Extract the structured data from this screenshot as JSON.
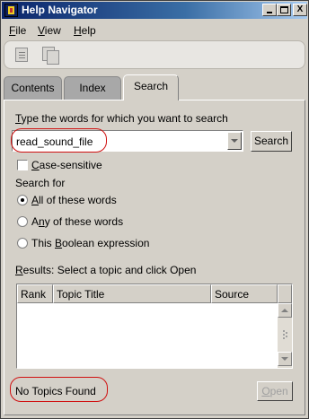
{
  "window": {
    "title": "Help Navigator",
    "controls": {
      "minimize": "minimize",
      "maximize": "maximize",
      "close": "X"
    }
  },
  "menu": {
    "file": {
      "first": "F",
      "rest": "ile"
    },
    "view": {
      "first": "V",
      "rest": "iew"
    },
    "help": {
      "first": "H",
      "rest": "elp"
    }
  },
  "toolbar": {
    "icons": [
      "document-icon",
      "copy-documents-icon"
    ]
  },
  "tabs": {
    "contents": "Contents",
    "index": "Index",
    "search": "Search"
  },
  "search": {
    "prompt_first": "T",
    "prompt_rest": "ype the words for which you want to search",
    "query": "read_sound_file",
    "button": "Search",
    "case_sensitive": {
      "first": "C",
      "rest": "ase-sensitive",
      "checked": false
    },
    "search_for_label": "Search for",
    "options": [
      {
        "first": "A",
        "rest": "ll of these words",
        "checked": true
      },
      {
        "first": "",
        "mid": "A",
        "pre": "",
        "label_pre": "A",
        "label_u": "n",
        "label_post": "y of these words",
        "checked": false
      },
      {
        "label_pre": "This ",
        "label_u": "B",
        "label_post": "oolean expression",
        "checked": false
      }
    ]
  },
  "results": {
    "label_first": "R",
    "label_rest": "esults: Select a topic and click Open",
    "columns": [
      "Rank",
      "Topic Title",
      "Source"
    ],
    "rows": []
  },
  "status": {
    "message": "No Topics Found"
  },
  "open_button": {
    "first": "O",
    "rest": "pen",
    "enabled": false
  },
  "colors": {
    "annotation_red": "#d01010",
    "titlebar": "#0a246a"
  }
}
